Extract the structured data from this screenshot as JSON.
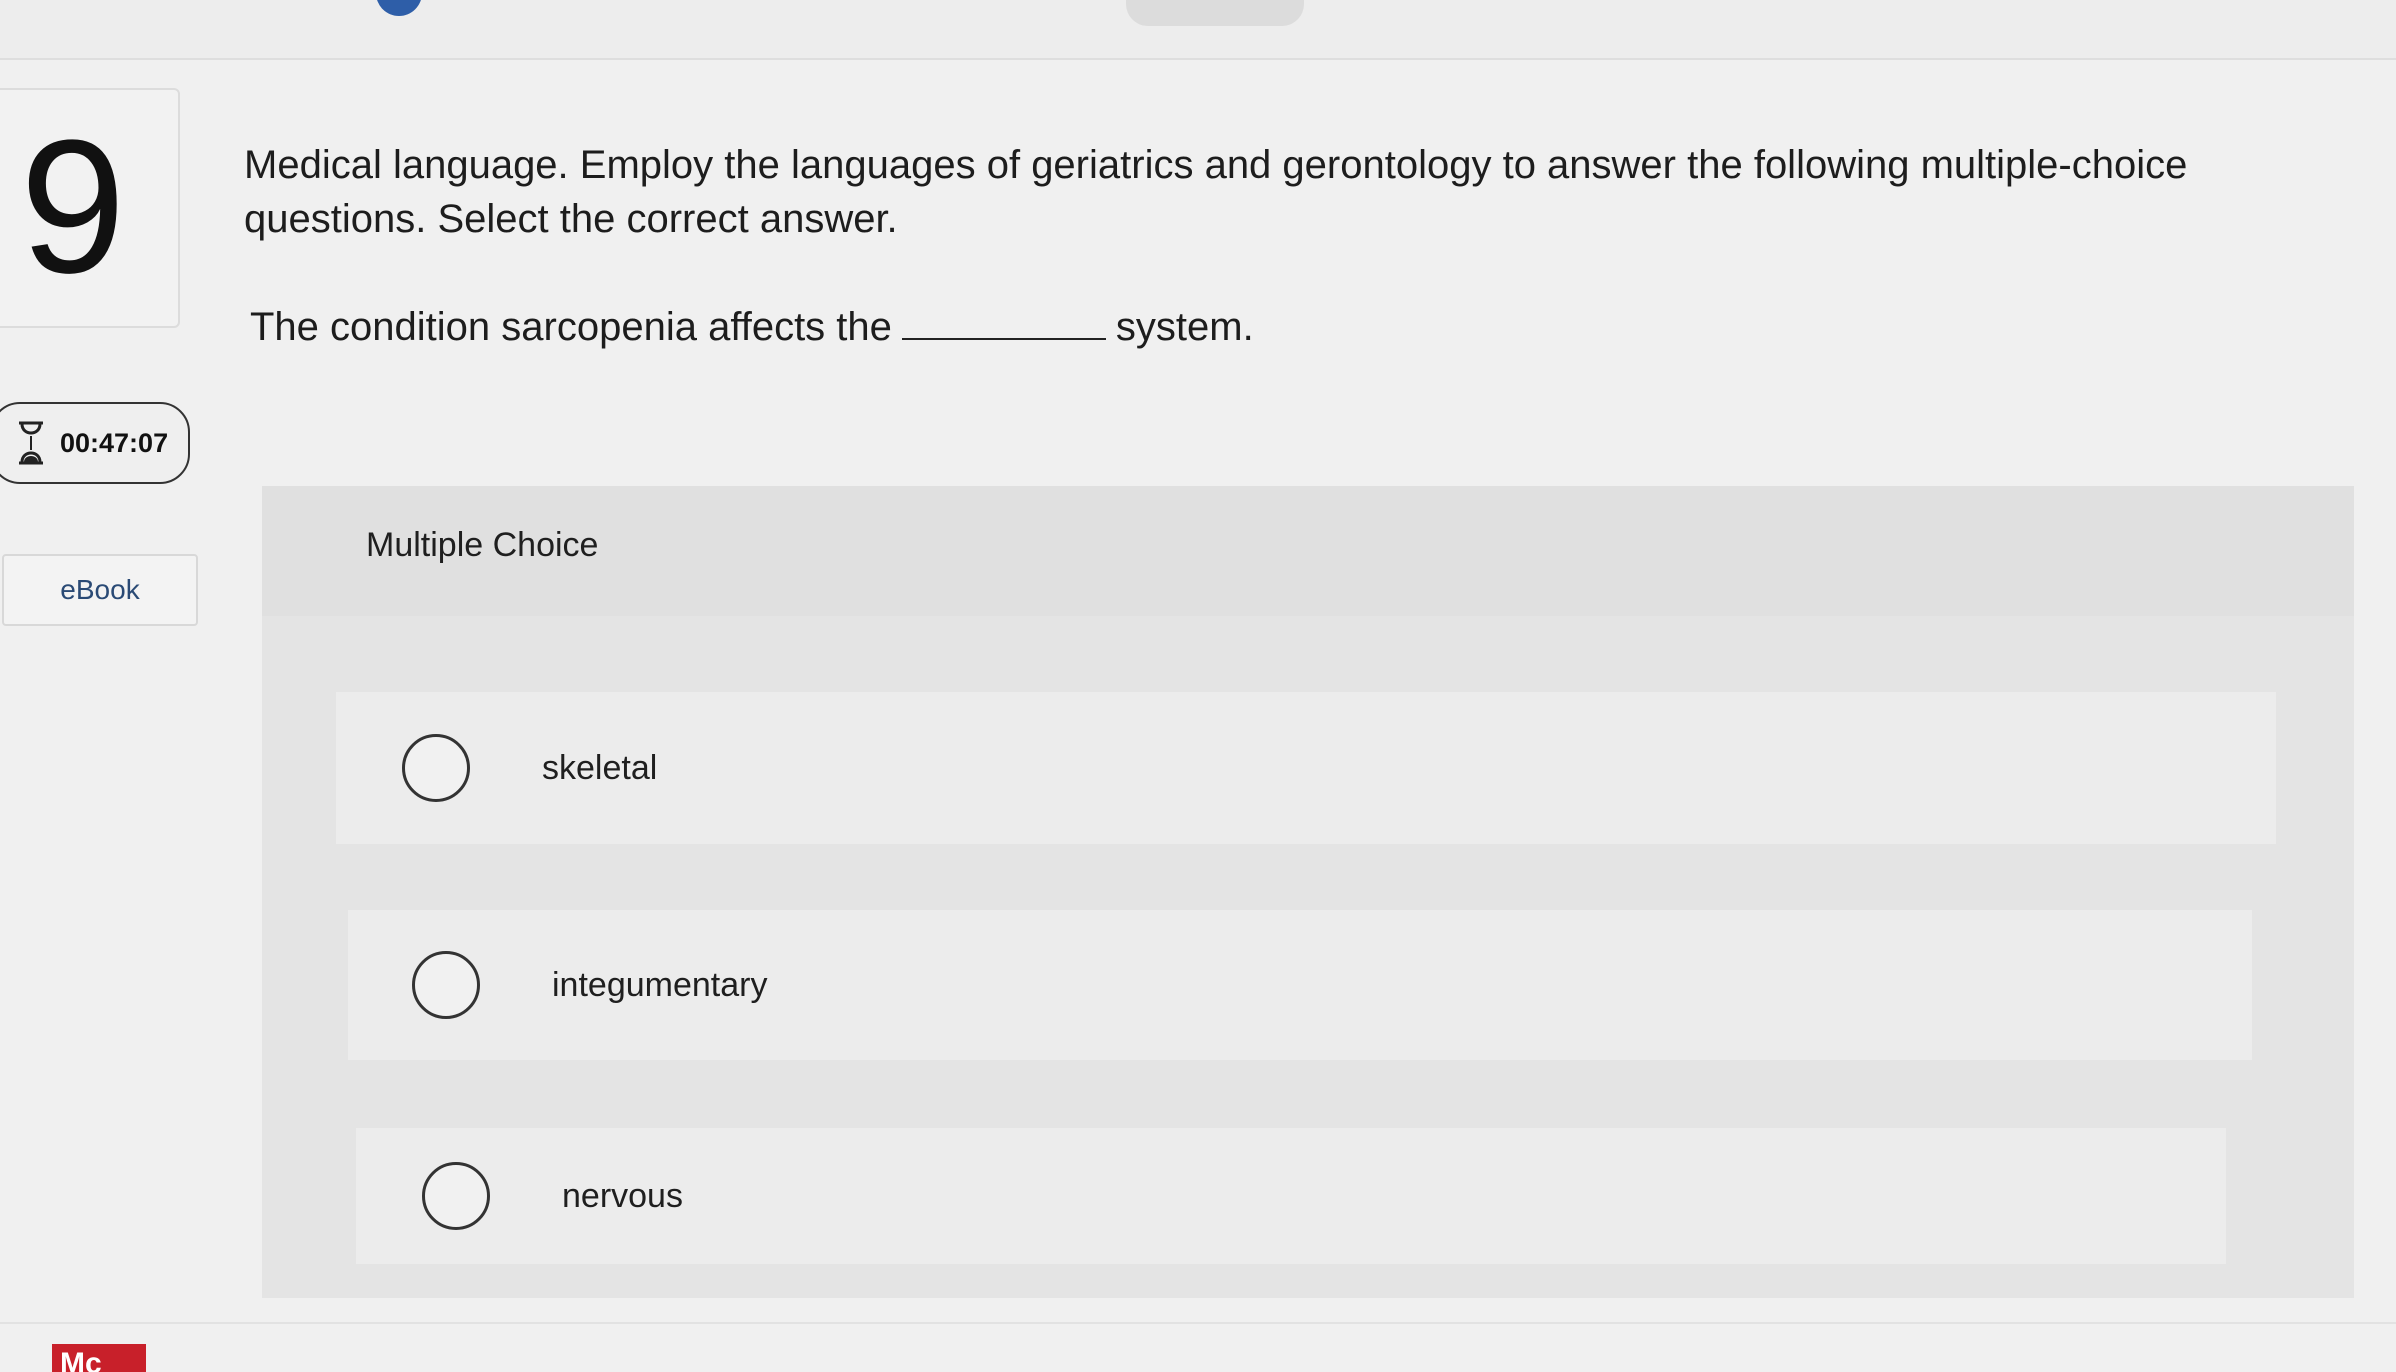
{
  "question": {
    "number": "9",
    "prompt": "Medical language. Employ the languages of geriatrics and gerontology to answer the following multiple-choice questions. Select the correct answer.",
    "stem_before": "The condition sarcopenia affects the",
    "stem_after": "system."
  },
  "timer": {
    "icon": "hourglass-icon",
    "value": "00:47:07"
  },
  "sidebar": {
    "ebook_label": "eBook"
  },
  "multiple_choice": {
    "title": "Multiple Choice",
    "options": [
      {
        "label": "skeletal",
        "selected": false
      },
      {
        "label": "integumentary",
        "selected": false
      },
      {
        "label": "nervous",
        "selected": false
      }
    ]
  },
  "footer": {
    "logo_text": "Mc"
  },
  "colors": {
    "background": "#f0f0f0",
    "panel": "#e4e4e4",
    "logo": "#c8202a",
    "ebook_text": "#2a4a75"
  }
}
